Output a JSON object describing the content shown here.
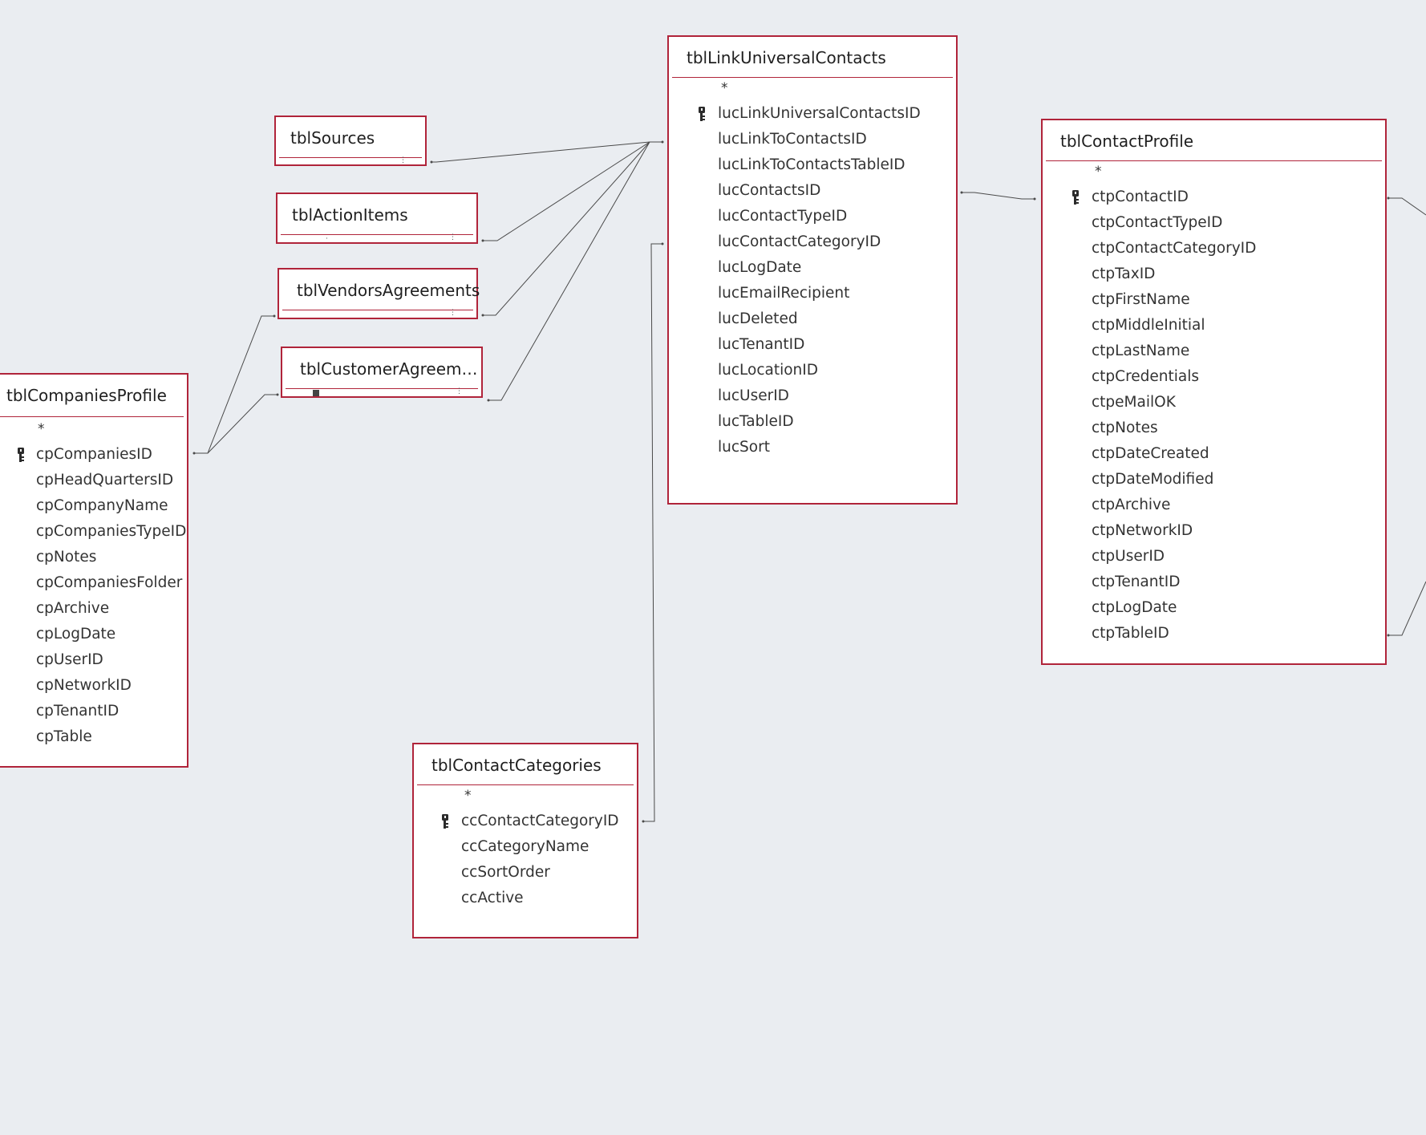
{
  "tables": {
    "sources": {
      "title": "tblSources",
      "fields": []
    },
    "action_items": {
      "title": "tblActionItems",
      "fields": []
    },
    "vendors_agreements": {
      "title": "tblVendorsAgreements",
      "fields": []
    },
    "customer_agreements": {
      "title": "tblCustomerAgreemen...",
      "fields": []
    },
    "companies_profile": {
      "title": "tblCompaniesProfile",
      "all_marker": "*",
      "fields": [
        "cpCompaniesID",
        "cpHeadQuartersID",
        "cpCompanyName",
        "cpCompaniesTypeID",
        "cpNotes",
        "cpCompaniesFolder",
        "cpArchive",
        "cpLogDate",
        "cpUserID",
        "cpNetworkID",
        "cpTenantID",
        "cpTable"
      ]
    },
    "link_universal_contacts": {
      "title": "tblLinkUniversalContacts",
      "all_marker": "*",
      "fields": [
        "lucLinkUniversalContactsID",
        "lucLinkToContactsID",
        "lucLinkToContactsTableID",
        "lucContactsID",
        "lucContactTypeID",
        "lucContactCategoryID",
        "lucLogDate",
        "lucEmailRecipient",
        "lucDeleted",
        "lucTenantID",
        "lucLocationID",
        "lucUserID",
        "lucTableID",
        "lucSort"
      ]
    },
    "contact_profile": {
      "title": "tblContactProfile",
      "all_marker": "*",
      "fields": [
        "ctpContactID",
        "ctpContactTypeID",
        "ctpContactCategoryID",
        "ctpTaxID",
        "ctpFirstName",
        "ctpMiddleInitial",
        "ctpLastName",
        "ctpCredentials",
        "ctpeMailOK",
        "ctpNotes",
        "ctpDateCreated",
        "ctpDateModified",
        "ctpArchive",
        "ctpNetworkID",
        "ctpUserID",
        "ctpTenantID",
        "ctpLogDate",
        "ctpTableID"
      ]
    },
    "contact_categories": {
      "title": "tblContactCategories",
      "all_marker": "*",
      "fields": [
        "ccContactCategoryID",
        "ccCategoryName",
        "ccSortOrder",
        "ccActive"
      ]
    }
  },
  "icons": {
    "primary_key": "key-icon"
  },
  "colors": {
    "canvas": "#eaedf1",
    "table_border": "#b0243a",
    "relationship_line": "#4a4a4a"
  }
}
